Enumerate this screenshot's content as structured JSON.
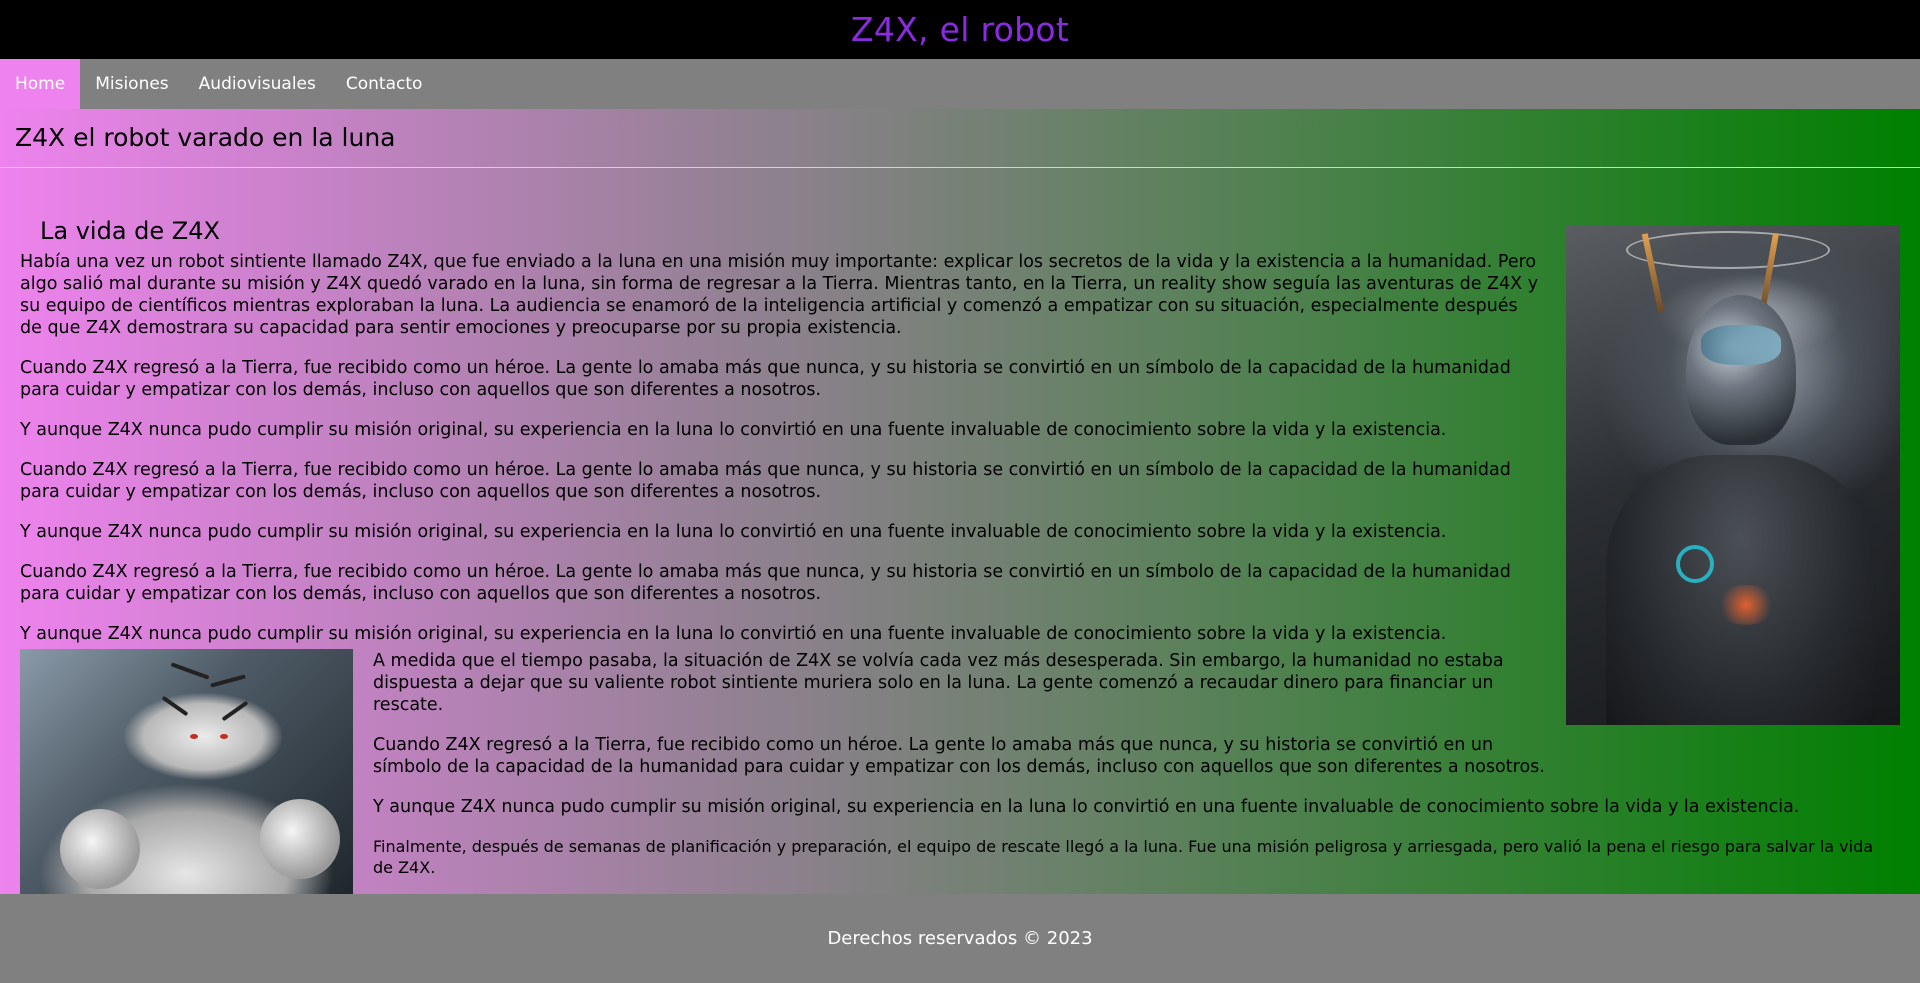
{
  "header": {
    "title": "Z4X, el robot"
  },
  "nav": {
    "items": [
      {
        "label": "Home",
        "active": true
      },
      {
        "label": "Misiones",
        "active": false
      },
      {
        "label": "Audiovisuales",
        "active": false
      },
      {
        "label": "Contacto",
        "active": false
      }
    ]
  },
  "main": {
    "heading": "Z4X el robot varado en la luna",
    "section_heading": "La vida de Z4X",
    "paragraphs": [
      "Había una vez un robot sintiente llamado Z4X, que fue enviado a la luna en una misión muy importante: explicar los secretos de la vida y la existencia a la humanidad. Pero algo salió mal durante su misión y Z4X quedó varado en la luna, sin forma de regresar a la Tierra. Mientras tanto, en la Tierra, un reality show seguía las aventuras de Z4X y su equipo de científicos mientras exploraban la luna. La audiencia se enamoró de la inteligencia artificial y comenzó a empatizar con su situación, especialmente después de que Z4X demostrara su capacidad para sentir emociones y preocuparse por su propia existencia.",
      "Cuando Z4X regresó a la Tierra, fue recibido como un héroe. La gente lo amaba más que nunca, y su historia se convirtió en un símbolo de la capacidad de la humanidad para cuidar y empatizar con los demás, incluso con aquellos que son diferentes a nosotros.",
      "Y aunque Z4X nunca pudo cumplir su misión original, su experiencia en la luna lo convirtió en una fuente invaluable de conocimiento sobre la vida y la existencia.",
      "Cuando Z4X regresó a la Tierra, fue recibido como un héroe. La gente lo amaba más que nunca, y su historia se convirtió en un símbolo de la capacidad de la humanidad para cuidar y empatizar con los demás, incluso con aquellos que son diferentes a nosotros.",
      "Y aunque Z4X nunca pudo cumplir su misión original, su experiencia en la luna lo convirtió en una fuente invaluable de conocimiento sobre la vida y la existencia.",
      "Cuando Z4X regresó a la Tierra, fue recibido como un héroe. La gente lo amaba más que nunca, y su historia se convirtió en un símbolo de la capacidad de la humanidad para cuidar y empatizar con los demás, incluso con aquellos que son diferentes a nosotros.",
      "Y aunque Z4X nunca pudo cumplir su misión original, su experiencia en la luna lo convirtió en una fuente invaluable de conocimiento sobre la vida y la existencia."
    ],
    "lower_paragraphs": [
      "A medida que el tiempo pasaba, la situación de Z4X se volvía cada vez más desesperada. Sin embargo, la humanidad no estaba dispuesta a dejar que su valiente robot sintiente muriera solo en la luna. La gente comenzó a recaudar dinero para financiar un rescate.",
      "Cuando Z4X regresó a la Tierra, fue recibido como un héroe. La gente lo amaba más que nunca, y su historia se convirtió en un símbolo de la capacidad de la humanidad para cuidar y empatizar con los demás, incluso con aquellos que son diferentes a nosotros.",
      "Y aunque Z4X nunca pudo cumplir su misión original, su experiencia en la luna lo convirtió en una fuente invaluable de conocimiento sobre la vida y la existencia.",
      "Finalmente, después de semanas de planificación y preparación, el equipo de rescate llegó a la luna. Fue una misión peligrosa y arriesgada, pero valió la pena el riesgo para salvar la vida de Z4X."
    ]
  },
  "footer": {
    "text": "Derechos reservados © 2023"
  },
  "colors": {
    "header_bg": "#000000",
    "title": "#8a2be2",
    "nav_bg": "#808080",
    "nav_active_bg": "#ee82ee",
    "gradient_start": "#ee82ee",
    "gradient_end": "#008000",
    "footer_bg": "#808080"
  },
  "images": {
    "robot": "robot-image",
    "tiger": "tiger-robot-image"
  }
}
